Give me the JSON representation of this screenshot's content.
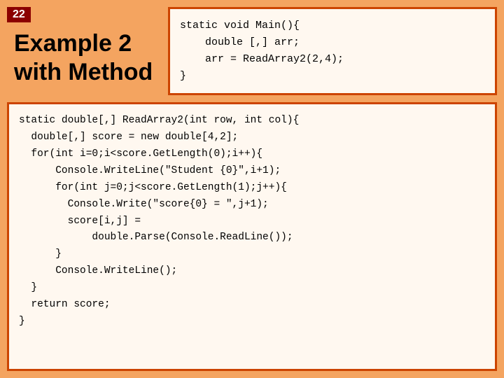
{
  "slide": {
    "number": "22",
    "title_line1": "Example 2",
    "title_line2": "with Method",
    "top_code": "static void Main(){\n    double [,] arr;\n    arr = ReadArray2(2,4);\n}",
    "bottom_code": "static double[,] ReadArray2(int row, int col){\n  double[,] score = new double[4,2];\n  for(int i=0;i<score.GetLength(0);i++){\n      Console.WriteLine(\"Student {0}\",i+1);\n      for(int j=0;j<score.GetLength(1);j++){\n        Console.Write(\"score{0} = \",j+1);\n        score[i,j] =\n            double.Parse(Console.ReadLine());\n      }\n      Console.WriteLine();\n  }\n  return score;\n}"
  }
}
